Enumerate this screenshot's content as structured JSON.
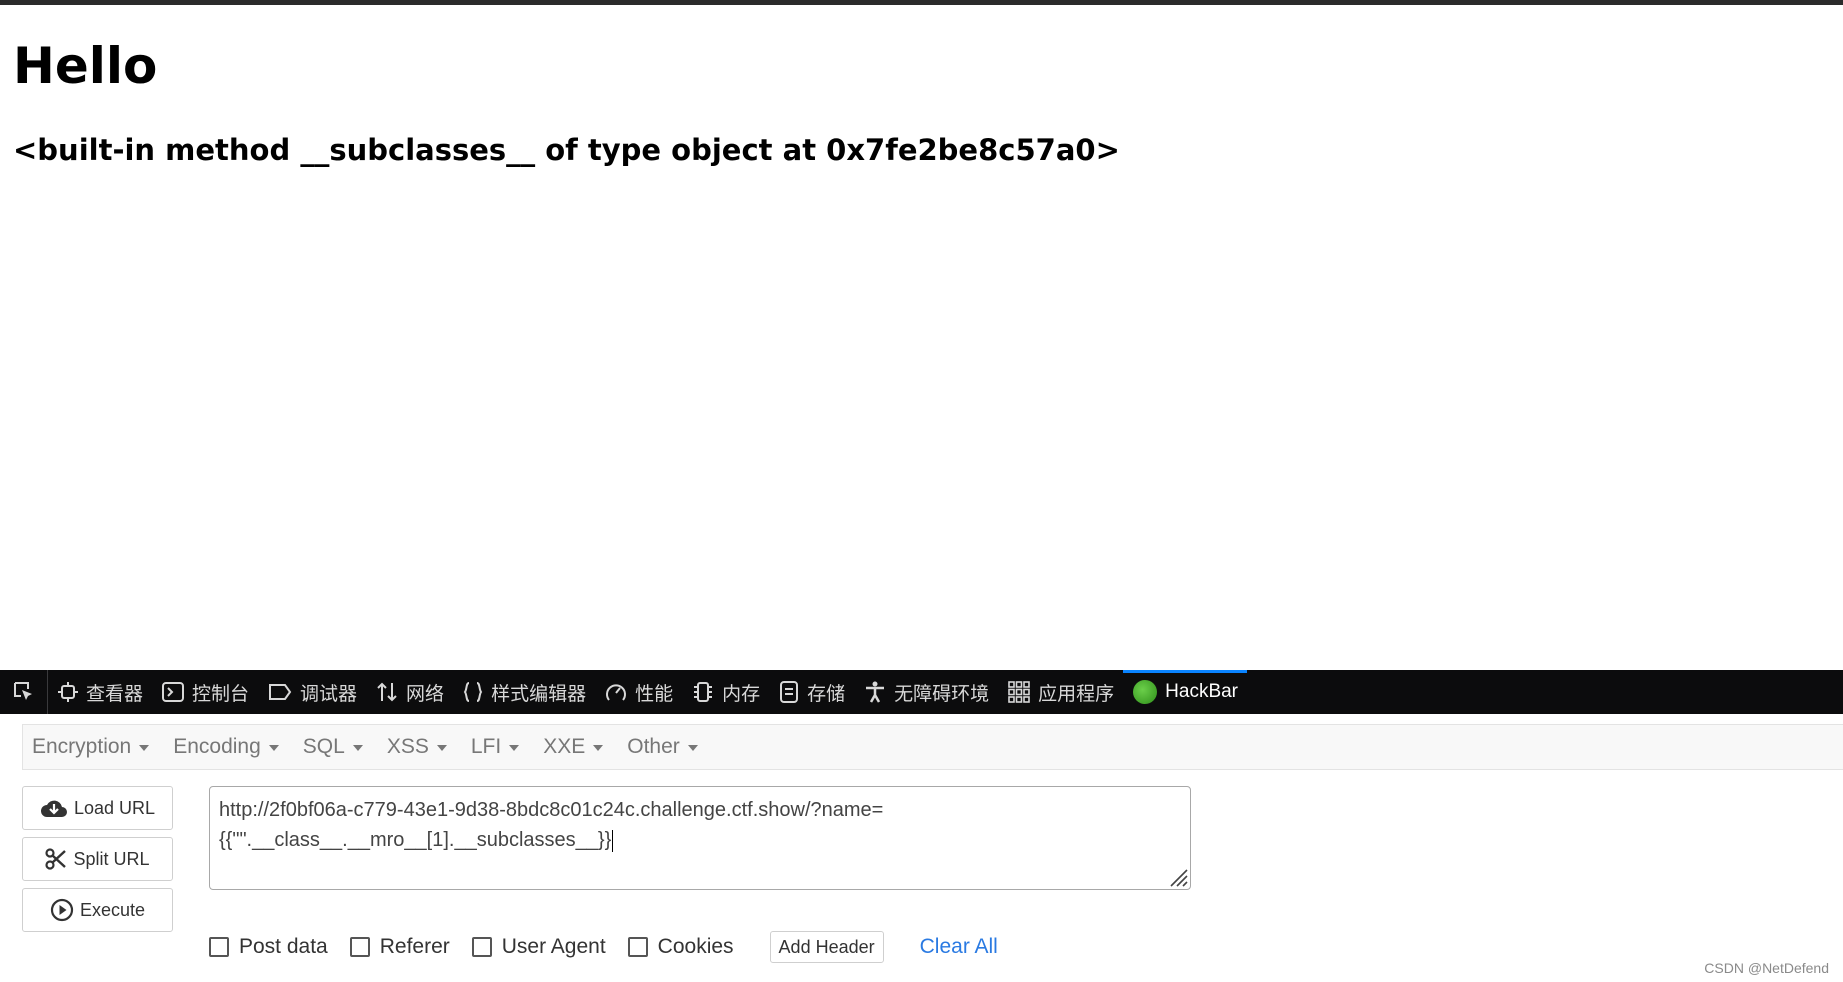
{
  "page": {
    "heading": "Hello",
    "result": "<built-in method __subclasses__ of type object at 0x7fe2be8c57a0>"
  },
  "devtools": {
    "tabs": [
      {
        "label": "查看器",
        "icon": "inspector-icon"
      },
      {
        "label": "控制台",
        "icon": "console-icon"
      },
      {
        "label": "调试器",
        "icon": "debugger-icon"
      },
      {
        "label": "网络",
        "icon": "network-icon"
      },
      {
        "label": "样式编辑器",
        "icon": "style-editor-icon"
      },
      {
        "label": "性能",
        "icon": "performance-icon"
      },
      {
        "label": "内存",
        "icon": "memory-icon"
      },
      {
        "label": "存储",
        "icon": "storage-icon"
      },
      {
        "label": "无障碍环境",
        "icon": "accessibility-icon"
      },
      {
        "label": "应用程序",
        "icon": "application-icon"
      },
      {
        "label": "HackBar",
        "icon": "hackbar-icon"
      }
    ],
    "active_tab": "HackBar"
  },
  "hackbar": {
    "menu": [
      "Encryption",
      "Encoding",
      "SQL",
      "XSS",
      "LFI",
      "XXE",
      "Other"
    ],
    "buttons": {
      "load_url": "Load URL",
      "split_url": "Split URL",
      "execute": "Execute"
    },
    "url_line1": "http://2f0bf06a-c779-43e1-9d38-8bdc8c01c24c.challenge.ctf.show/?name=",
    "url_line2": "{{\"\".__class__.__mro__[1].__subclasses__}}",
    "options": {
      "post_data": "Post data",
      "referer": "Referer",
      "user_agent": "User Agent",
      "cookies": "Cookies"
    },
    "add_header": "Add Header",
    "clear_all": "Clear All"
  },
  "watermark": "CSDN @NetDefend",
  "colors": {
    "devtools_bg": "#0c0c0d",
    "active_tab_accent": "#0a84ff",
    "link_blue": "#2a7ae2"
  }
}
